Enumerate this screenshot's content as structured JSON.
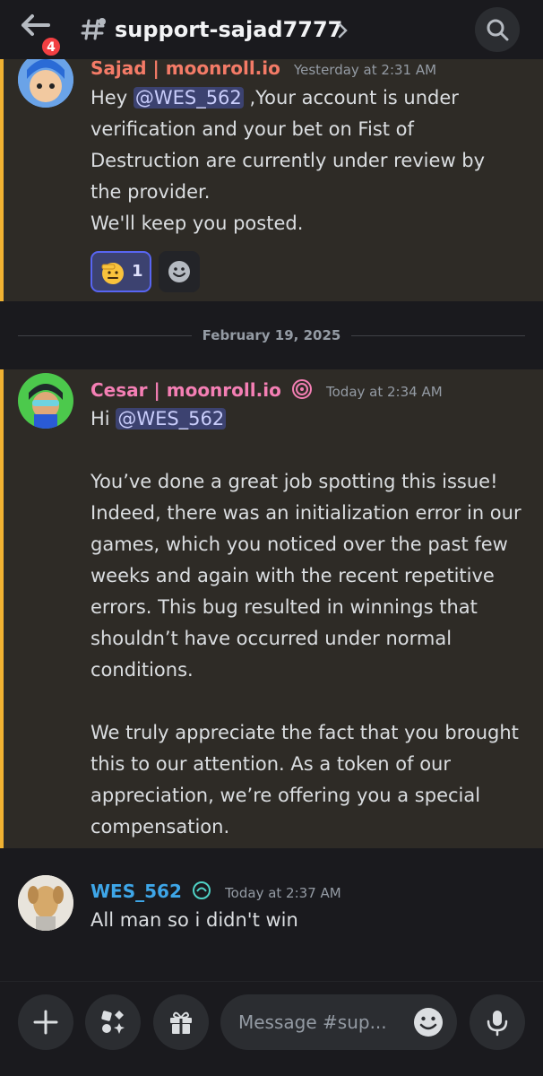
{
  "header": {
    "channel_name": "support-sajad7777",
    "unread_badge": "4"
  },
  "messages": [
    {
      "author": "Sajad | moonroll.io",
      "author_color": "#f47b67",
      "timestamp": "Yesterday at 2:31 AM",
      "lines": {
        "l1_pre": "Hey ",
        "l1_mention": "@WES_562",
        "l1_post": " ,Your account is under",
        "l2": "verification and your bet on Fist of",
        "l3": "Destruction are currently under review by",
        "l4": "the provider.",
        "l5": "We'll keep you posted."
      },
      "reactions": [
        {
          "emoji": "saluting-face",
          "count": "1"
        },
        {
          "emoji": "add-reaction"
        }
      ]
    },
    {
      "author": "Cesar | moonroll.io",
      "author_color": "#f47fb4",
      "timestamp": "Today at 2:34 AM",
      "lines": {
        "l1_pre": "Hi ",
        "l1_mention": "@WES_562",
        "p1": "You’ve done a great job spotting this issue! Indeed, there was an initialization error in our games, which you noticed over the past few weeks and again with the recent repetitive errors. This bug resulted in winnings that shouldn’t have occurred under normal conditions.",
        "p2": "We truly appreciate the fact that you brought this to our attention. As a token of our appreciation, we’re offering you a special compensation."
      }
    },
    {
      "author": "WES_562",
      "author_color": "#3ea6e8",
      "timestamp": "Today at 2:37 AM",
      "text": "All man so i didn't win"
    }
  ],
  "date_divider": "February 19, 2025",
  "composer": {
    "placeholder": "Message #sup..."
  },
  "colors": {
    "background": "#1a1a1e",
    "highlight": "#2e2b26",
    "highlight_border": "#f0b232",
    "mention_bg": "#3c4270",
    "badge": "#f23f42"
  }
}
